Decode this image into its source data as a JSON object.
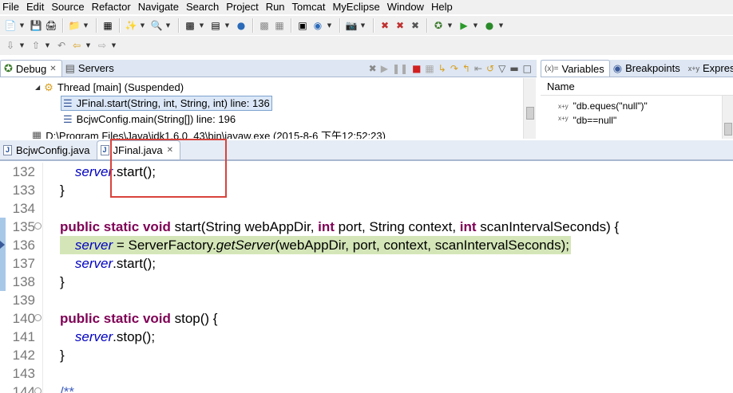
{
  "menubar": [
    "File",
    "Edit",
    "Source",
    "Refactor",
    "Navigate",
    "Search",
    "Project",
    "Run",
    "Tomcat",
    "MyEclipse",
    "Window",
    "Help"
  ],
  "debug_views": {
    "debug_tab": "Debug",
    "servers_tab": "Servers"
  },
  "variables_views": {
    "variables_tab": "Variables",
    "breakpoints_tab": "Breakpoints",
    "expressions_tab": "Expres",
    "column_name": "Name",
    "items": [
      "\"db.eques(\"null\")\"",
      "\"db==null\""
    ]
  },
  "debug_tree": {
    "thread": "Thread [main] (Suspended)",
    "frames": [
      "JFinal.start(String, int, String, int) line: 136",
      "BcjwConfig.main(String[]) line: 196"
    ],
    "process": "D:\\Program Files\\Java\\jdk1.6.0_43\\bin\\javaw.exe (2015-8-6 下午12:52:23)"
  },
  "editor": {
    "tabs": [
      "BcjwConfig.java",
      "JFinal.java"
    ],
    "active_tab": "JFinal.java",
    "current_line": 136,
    "lines": [
      {
        "n": "132",
        "text": "    server.start();"
      },
      {
        "n": "133",
        "text": "}"
      },
      {
        "n": "134",
        "text": ""
      },
      {
        "n": "135",
        "text": "public static void start(String webAppDir, int port, String context, int scanIntervalSeconds) {"
      },
      {
        "n": "136",
        "text": "    server = ServerFactory.getServer(webAppDir, port, context, scanIntervalSeconds);"
      },
      {
        "n": "137",
        "text": "    server.start();"
      },
      {
        "n": "138",
        "text": "}"
      },
      {
        "n": "139",
        "text": ""
      },
      {
        "n": "140",
        "text": "public static void stop() {"
      },
      {
        "n": "141",
        "text": "    server.stop();"
      },
      {
        "n": "142",
        "text": "}"
      },
      {
        "n": "143",
        "text": ""
      },
      {
        "n": "144",
        "text": "/**"
      }
    ]
  },
  "colors": {
    "keyword": "#7f0055",
    "field": "#0000c0",
    "current_line_bg": "#d4e6b8",
    "highlight_box": "#d9433b"
  }
}
